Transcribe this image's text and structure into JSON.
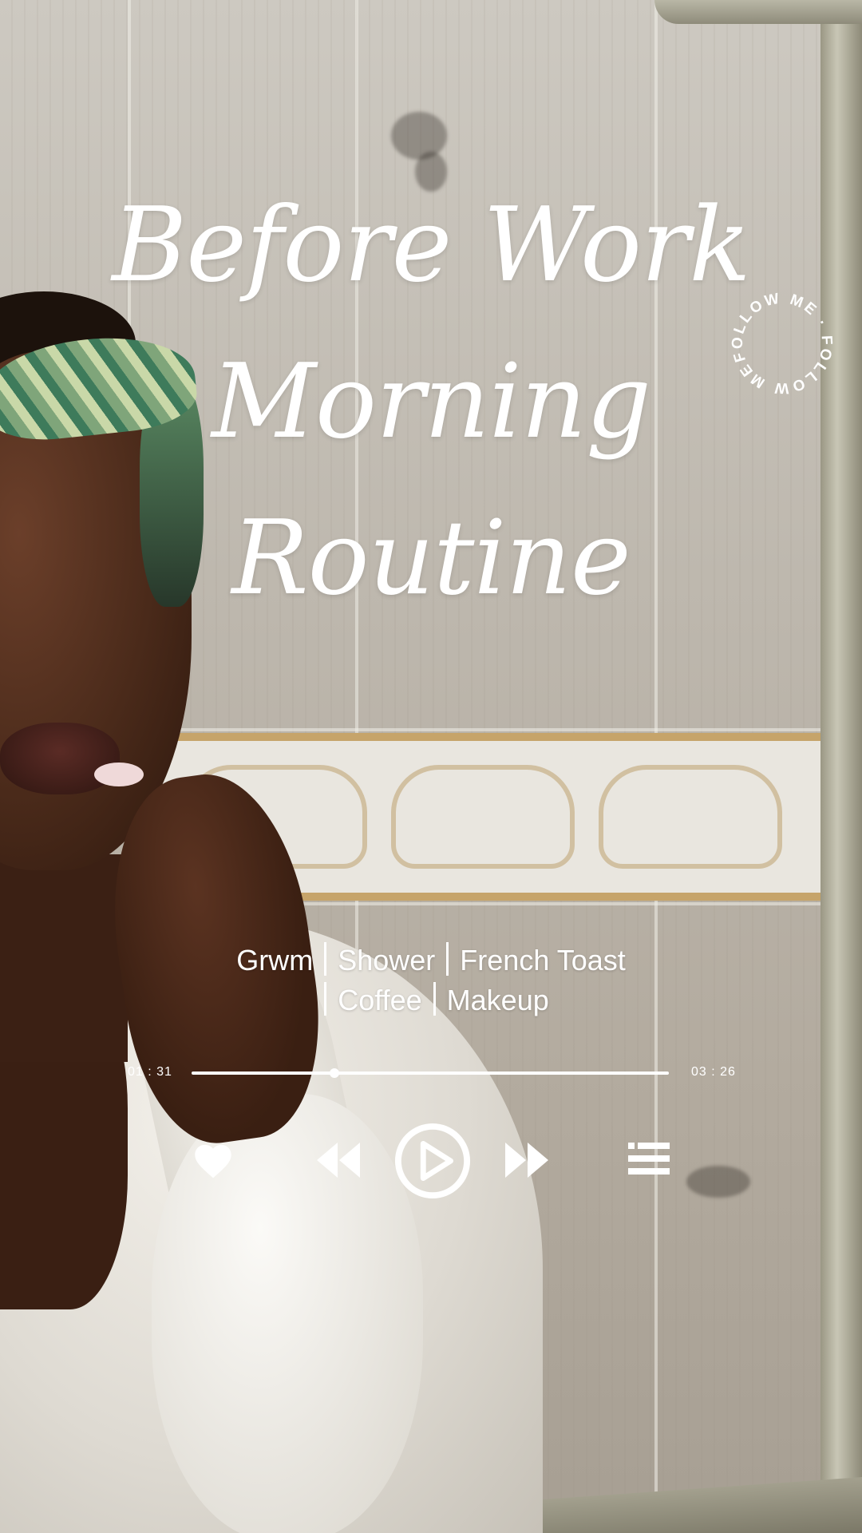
{
  "title": {
    "line1": "Before Work",
    "line2": "Morning",
    "line3": "Routine"
  },
  "badge": {
    "text": "FOLLOW ME · FOLLOW ME ·"
  },
  "subtitle": {
    "line1": [
      "Grwm",
      "Shower",
      "French Toast"
    ],
    "line2": [
      "Coffee",
      "Makeup"
    ]
  },
  "player": {
    "elapsed": "01 : 31",
    "duration": "03 : 26",
    "progress": 0.3
  },
  "controls": {
    "like_icon": "heart-icon",
    "prev_icon": "rewind-icon",
    "play_icon": "play-icon",
    "next_icon": "fast-forward-icon",
    "queue_icon": "list-icon"
  },
  "colors": {
    "overlay_text": "#ffffff"
  }
}
